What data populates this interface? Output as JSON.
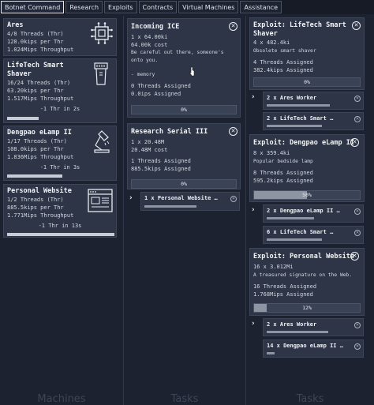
{
  "tabs": [
    {
      "label": "Botnet Command",
      "active": true
    },
    {
      "label": "Research"
    },
    {
      "label": "Exploits"
    },
    {
      "label": "Contracts"
    },
    {
      "label": "Virtual Machines"
    },
    {
      "label": "Assistance"
    }
  ],
  "columns": {
    "machines": "Machines",
    "tasks1": "Tasks",
    "tasks2": "Tasks"
  },
  "machines": [
    {
      "name": "Ares",
      "threads": "4/8 Threads (Thr)",
      "kips": "128.0kips per Thr",
      "throughput": "1.024Mips Throughput",
      "icon": "cpu-chip-icon",
      "thr_in": ""
    },
    {
      "name": "LifeTech Smart Shaver",
      "threads": "16/24 Threads (Thr)",
      "kips": "63.20kips per Thr",
      "throughput": "1.517Mips Throughput",
      "icon": "shaver-icon",
      "thr_in": "-1 Thr in 2s"
    },
    {
      "name": "Dengpao eLamp II",
      "threads": "1/17 Threads (Thr)",
      "kips": "108.0kips per Thr",
      "throughput": "1.836Mips Throughput",
      "icon": "desk-lamp-icon",
      "thr_in": "-1 Thr in 3s"
    },
    {
      "name": "Personal Website",
      "threads": "1/2 Threads (Thr)",
      "kips": "885.5kips per Thr",
      "throughput": "1.771Mips Throughput",
      "icon": "browser-window-icon",
      "thr_in": "-1 Thr in 13s"
    }
  ],
  "incoming": {
    "title": "Incoming ICE",
    "qty": "1 x 64.00ki",
    "cost": "64.00k cost",
    "desc1": "Be careful out there, someone's",
    "desc2": "onto you.",
    "tag": "- memory",
    "threads": "0 Threads Assigned",
    "rate": "0.0ips Assigned",
    "progress": "0%",
    "progress_value": 0
  },
  "research": {
    "title": "Research Serial III",
    "qty": "1 x 20.48M",
    "cost": "20.48M cost",
    "threads": "1 Threads Assigned",
    "rate": "885.5kips Assigned",
    "progress": "0%",
    "progress_value": 0,
    "sub": {
      "label": "1 x Personal Website …",
      "progress_value": 0.75
    }
  },
  "exploits": [
    {
      "title1": "Exploit: LifeTech Smart",
      "title2": "Shaver",
      "qty": "4 x 482.4ki",
      "desc": "Obsolete smart shaver",
      "threads": "4 Threads Assigned",
      "rate": "382.4kips Assigned",
      "progress": "0%",
      "progress_value": 0.0,
      "subs": [
        {
          "label": "2 x Ares Worker",
          "progress_value": 0.8
        },
        {
          "label": "2 x LifeTech Smart …",
          "progress_value": 0.7
        }
      ]
    },
    {
      "title1": "Exploit: Dengpao eLamp II",
      "title2": "",
      "qty": "8 x 359.4ki",
      "desc": "Popular bedside lamp",
      "threads": "8 Threads Assigned",
      "rate": "595.2kips Assigned",
      "progress": "50%",
      "progress_value": 0.5,
      "subs": [
        {
          "label": "2 x Dengpao eLamp II …",
          "progress_value": 0.6
        },
        {
          "label": "6 x LifeTech Smart …",
          "progress_value": 0.7
        }
      ]
    },
    {
      "title1": "Exploit: Personal Website",
      "title2": "",
      "qty": "16 x 3.012Mi",
      "desc": "A treasured signature on the Web.",
      "threads": "16 Threads Assigned",
      "rate": "1.768Mips Assigned",
      "progress": "12%",
      "progress_value": 0.12,
      "subs": [
        {
          "label": "2 x Ares Worker",
          "progress_value": 0.78
        },
        {
          "label": "14 x Dengpao eLamp II …",
          "progress_value": 0.1
        }
      ]
    }
  ]
}
